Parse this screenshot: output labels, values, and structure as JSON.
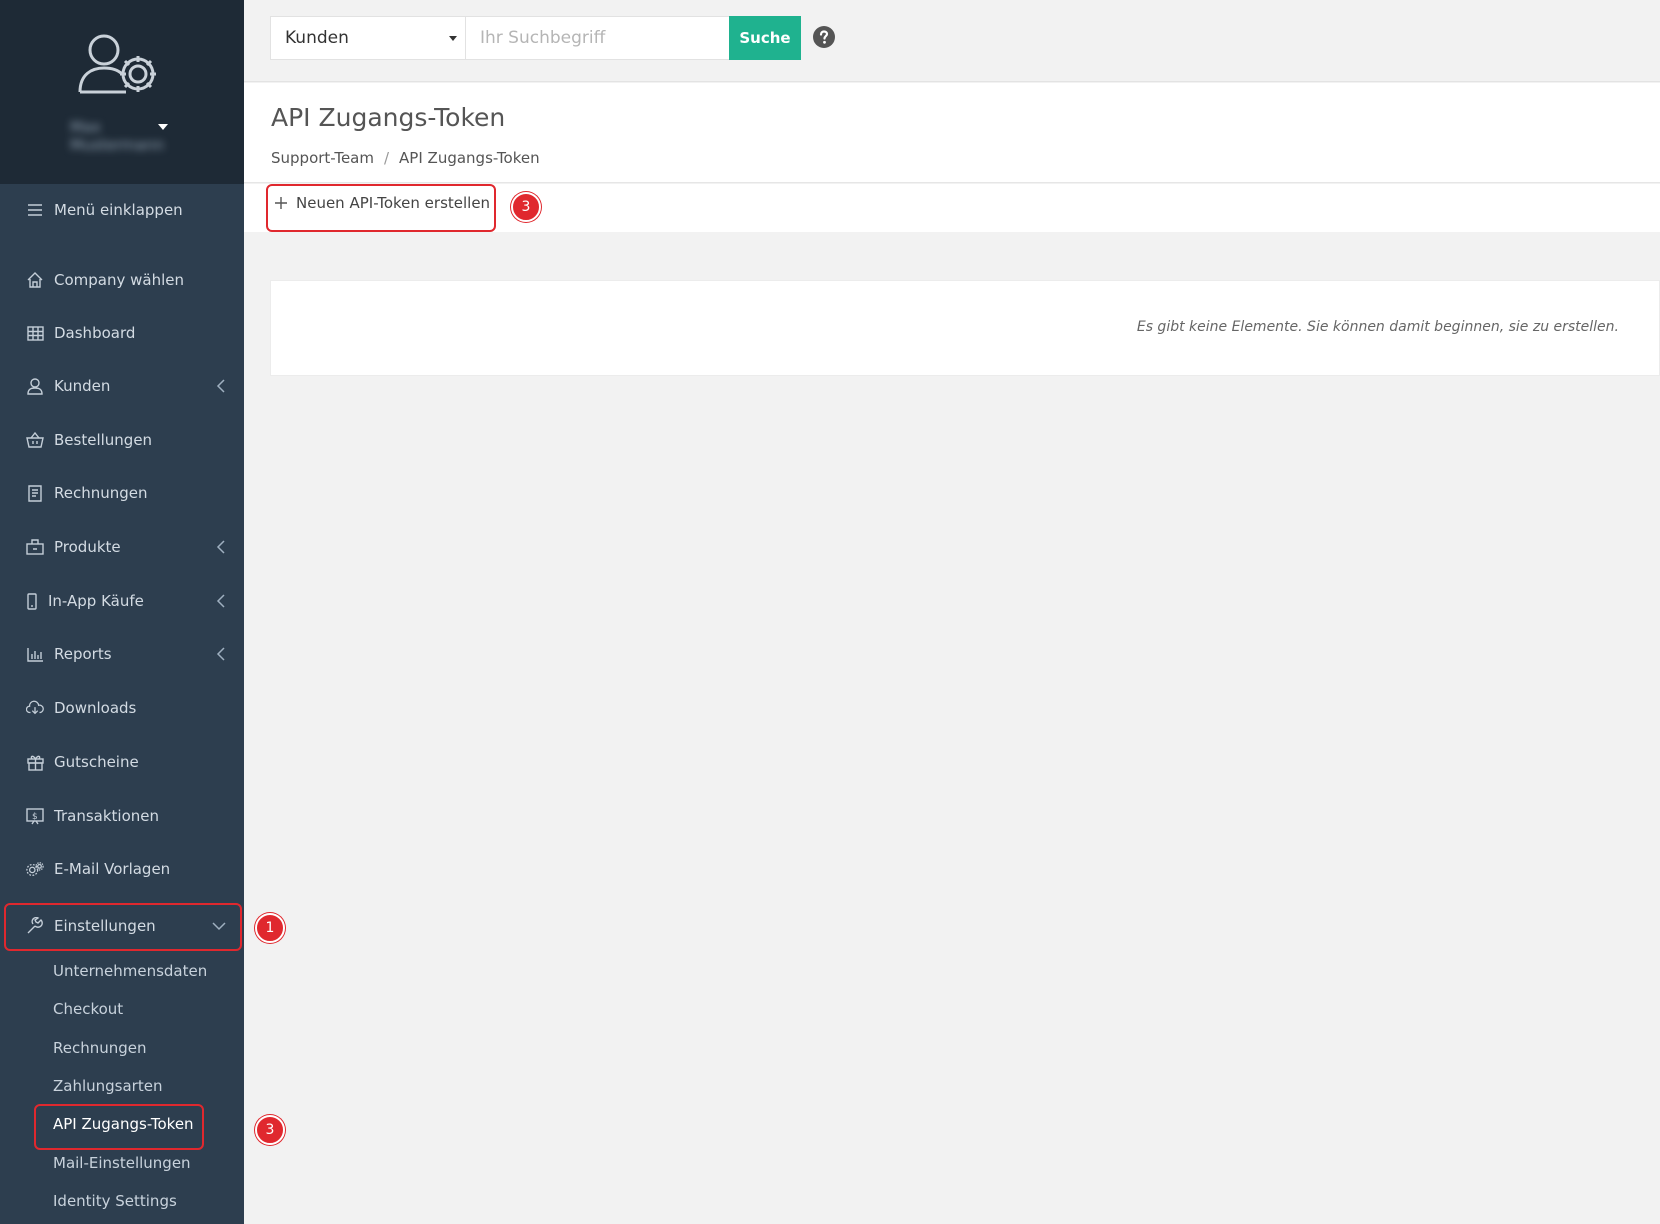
{
  "sidebar": {
    "user_name": "Max Mustermann",
    "collapse_label": "Menü einklappen",
    "items": [
      {
        "label": "Company wählen",
        "icon": "home-icon"
      },
      {
        "label": "Dashboard",
        "icon": "grid-icon"
      },
      {
        "label": "Kunden",
        "icon": "user-icon"
      },
      {
        "label": "Bestellungen",
        "icon": "basket-icon"
      },
      {
        "label": "Rechnungen",
        "icon": "receipt-icon"
      },
      {
        "label": "Produkte",
        "icon": "box-icon"
      },
      {
        "label": "In-App Käufe",
        "icon": "phone-icon"
      },
      {
        "label": "Reports",
        "icon": "bar-chart-icon"
      },
      {
        "label": "Downloads",
        "icon": "cloud-download-icon"
      },
      {
        "label": "Gutscheine",
        "icon": "gift-icon"
      },
      {
        "label": "Transaktionen",
        "icon": "dollar-screen-icon"
      },
      {
        "label": "E-Mail Vorlagen",
        "icon": "gears-icon"
      },
      {
        "label": "Einstellungen",
        "icon": "wrench-icon"
      }
    ],
    "settings_sub": [
      "Unternehmensdaten",
      "Checkout",
      "Rechnungen",
      "Zahlungsarten",
      "API Zugangs-Token",
      "Mail-Einstellungen",
      "Identity Settings"
    ]
  },
  "topbar": {
    "select_value": "Kunden",
    "search_placeholder": "Ihr Suchbegriff",
    "search_button": "Suche"
  },
  "page": {
    "title": "API Zugangs-Token",
    "breadcrumb": [
      "Support-Team",
      "API Zugangs-Token"
    ],
    "breadcrumb_sep": "/",
    "new_button": "Neuen API-Token erstellen",
    "empty_message": "Es gibt keine Elemente. Sie können damit beginnen, sie zu erstellen."
  },
  "annotations": {
    "badge_1": "1",
    "badge_3a": "3",
    "badge_3b": "3"
  },
  "colors": {
    "sidebar_bg": "#2d3e4f",
    "accent": "#1fb28f",
    "highlight": "#e0282e"
  }
}
